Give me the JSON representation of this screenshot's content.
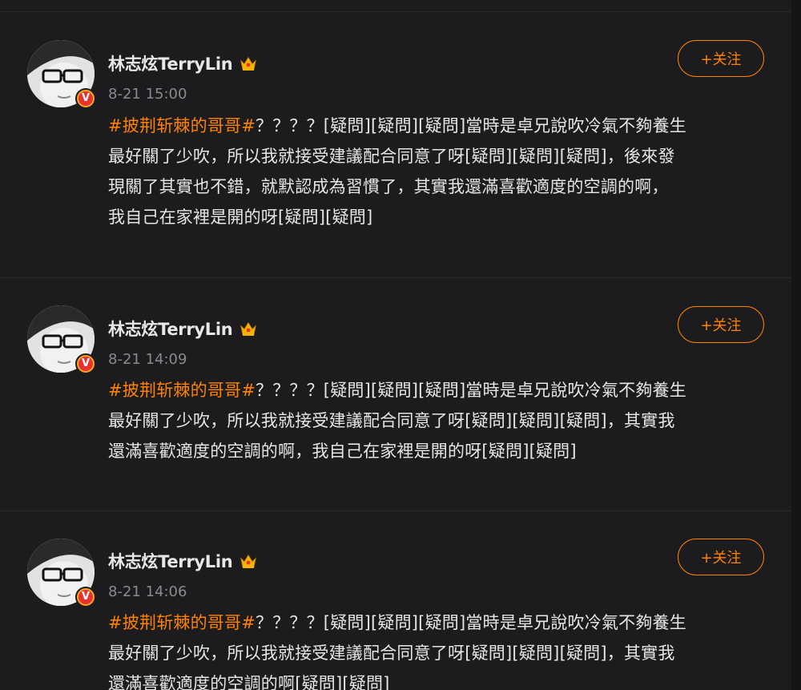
{
  "posts": [
    {
      "username": "林志炫TerryLin",
      "timestamp": "8-21 15:00",
      "follow_label": "+关注",
      "hashtag": "#披荆斩棘的哥哥#",
      "lines": [
        "？？？？[疑問][疑問][疑問]當時是卓兄說吹冷氣不夠養生",
        "最好關了少吹，所以我就接受建議配合同意了呀[疑問][疑問][疑問]，後來發",
        "現關了其實也不錯，就默認成為習慣了，其實我還滿喜歡適度的空調的啊，",
        "我自己在家裡是開的呀[疑問][疑問]"
      ]
    },
    {
      "username": "林志炫TerryLin",
      "timestamp": "8-21 14:09",
      "follow_label": "+关注",
      "hashtag": "#披荆斩棘的哥哥#",
      "lines": [
        "？？？？[疑問][疑問][疑問]當時是卓兄說吹冷氣不夠養生",
        "最好關了少吹，所以我就接受建議配合同意了呀[疑問][疑問][疑問]，其實我",
        "還滿喜歡適度的空調的啊，我自己在家裡是開的呀[疑問][疑問]"
      ]
    },
    {
      "username": "林志炫TerryLin",
      "timestamp": "8-21 14:06",
      "follow_label": "+关注",
      "hashtag": "#披荆斩棘的哥哥#",
      "lines": [
        "？？？？[疑問][疑問][疑問]當時是卓兄說吹冷氣不夠養生",
        "最好關了少吹，所以我就接受建議配合同意了呀[疑問][疑問][疑問]，其實我",
        "還滿喜歡適度的空調的啊[疑問][疑問]"
      ]
    }
  ],
  "colors": {
    "accent": "#ff8200",
    "background": "#1c1c1f",
    "text": "#e6e6e6",
    "muted": "#8a8a8e",
    "verified_badge": "#e8322e"
  },
  "icons": {
    "verified": "verified-v-icon",
    "member": "crown-icon"
  },
  "verified_letter": "V"
}
